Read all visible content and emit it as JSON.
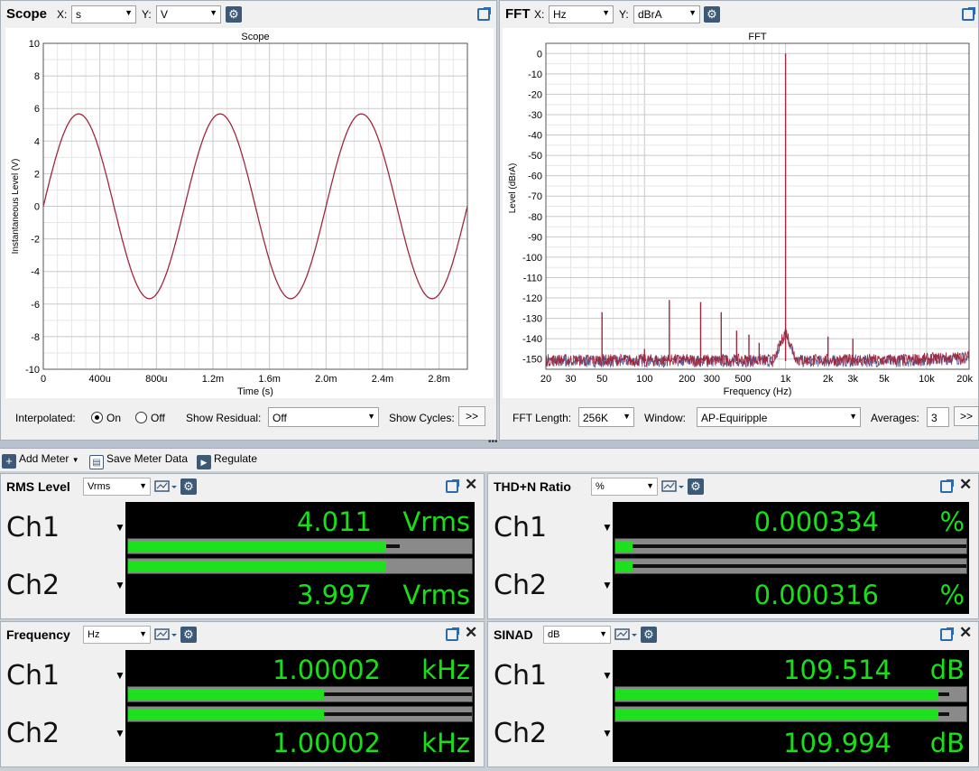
{
  "scope": {
    "title": "Scope",
    "x_label": "X:",
    "x_unit": "s",
    "y_label": "Y:",
    "y_unit": "V",
    "chart_title": "Scope",
    "interpolated_label": "Interpolated:",
    "on_label": "On",
    "off_label": "Off",
    "show_residual_label": "Show Residual:",
    "show_residual_value": "Off",
    "show_cycles_label": "Show Cycles:",
    "show_cycles_btn": ">>"
  },
  "fft": {
    "title": "FFT",
    "x_label": "X:",
    "x_unit": "Hz",
    "y_label": "Y:",
    "y_unit": "dBrA",
    "chart_title": "FFT",
    "fft_length_label": "FFT Length:",
    "fft_length_value": "256K",
    "window_label": "Window:",
    "window_value": "AP-Equiripple",
    "averages_label": "Averages:",
    "averages_value": "3",
    "more_btn": ">>"
  },
  "toolbar": {
    "add_meter": "Add Meter",
    "save_meter_data": "Save Meter Data",
    "regulate": "Regulate"
  },
  "meters": {
    "rms": {
      "title": "RMS Level",
      "unit_select": "Vrms",
      "ch1_label": "Ch1",
      "ch2_label": "Ch2",
      "ch1_value": "4.011",
      "ch2_value": "3.997",
      "ch1_unit": "Vrms",
      "ch2_unit": "Vrms"
    },
    "thdn": {
      "title": "THD+N Ratio",
      "unit_select": "%",
      "ch1_label": "Ch1",
      "ch2_label": "Ch2",
      "ch1_value": "0.000334",
      "ch2_value": "0.000316",
      "ch1_unit": "%",
      "ch2_unit": "%"
    },
    "freq": {
      "title": "Frequency",
      "unit_select": "Hz",
      "ch1_label": "Ch1",
      "ch2_label": "Ch2",
      "ch1_value": "1.00002",
      "ch2_value": "1.00002",
      "ch1_unit": "kHz",
      "ch2_unit": "kHz"
    },
    "sinad": {
      "title": "SINAD",
      "unit_select": "dB",
      "ch1_label": "Ch1",
      "ch2_label": "Ch2",
      "ch1_value": "109.514",
      "ch2_value": "109.994",
      "ch1_unit": "dB",
      "ch2_unit": "dB"
    }
  },
  "meter_bars": {
    "rms": {
      "ch1_fill": 0.75,
      "ch2_fill": 0.75,
      "ch1_peak": 0.79,
      "ch2_peak": 0.75
    },
    "thdn": {
      "ch1_fill": 0.05,
      "ch2_fill": 0.05,
      "ch1_peak": 1.0,
      "ch2_peak": 1.0
    },
    "freq": {
      "ch1_fill": 0.57,
      "ch2_fill": 0.57,
      "ch1_peak": 1.0,
      "ch2_peak": 1.0
    },
    "sinad": {
      "ch1_fill": 0.92,
      "ch2_fill": 0.92,
      "ch1_peak": 0.95,
      "ch2_peak": 0.95
    }
  },
  "colors": {
    "trace": "#a0283c",
    "trace2": "#2a3a8a",
    "meter_green": "#18e018"
  },
  "chart_data": [
    {
      "type": "line",
      "title": "Scope",
      "xlabel": "Time (s)",
      "ylabel": "Instantaneous Level (V)",
      "xlim": [
        0,
        0.003
      ],
      "ylim": [
        -10,
        10
      ],
      "x_ticks": [
        "0",
        "400u",
        "800u",
        "1.2m",
        "1.6m",
        "2.0m",
        "2.4m",
        "2.8m"
      ],
      "y_ticks": [
        "10",
        "8",
        "6",
        "4",
        "2",
        "0",
        "-2",
        "-4",
        "-6",
        "-8",
        "-10"
      ],
      "series": [
        {
          "amplitude": 5.67,
          "frequency_hz": 1000
        }
      ]
    },
    {
      "type": "line",
      "title": "FFT",
      "xlabel": "Frequency (Hz)",
      "ylabel": "Level (dBrA)",
      "xlim": [
        20,
        20000
      ],
      "ylim": [
        -155,
        5
      ],
      "x_scale": "log",
      "x_ticks": [
        "20",
        "30",
        "50",
        "100",
        "200",
        "300",
        "500",
        "1k",
        "2k",
        "3k",
        "5k",
        "10k",
        "20k"
      ],
      "y_ticks": [
        "0",
        "-10",
        "-20",
        "-30",
        "-40",
        "-50",
        "-60",
        "-70",
        "-80",
        "-90",
        "-100",
        "-110",
        "-120",
        "-130",
        "-140",
        "-150"
      ],
      "peaks": [
        {
          "x": 50,
          "y": -127
        },
        {
          "x": 100,
          "y": -145
        },
        {
          "x": 150,
          "y": -121
        },
        {
          "x": 250,
          "y": -122
        },
        {
          "x": 350,
          "y": -127
        },
        {
          "x": 450,
          "y": -136
        },
        {
          "x": 550,
          "y": -138
        },
        {
          "x": 650,
          "y": -142
        },
        {
          "x": 1000,
          "y": 0
        },
        {
          "x": 2000,
          "y": -139
        },
        {
          "x": 3000,
          "y": -140
        }
      ],
      "noise_floor": -151
    }
  ]
}
